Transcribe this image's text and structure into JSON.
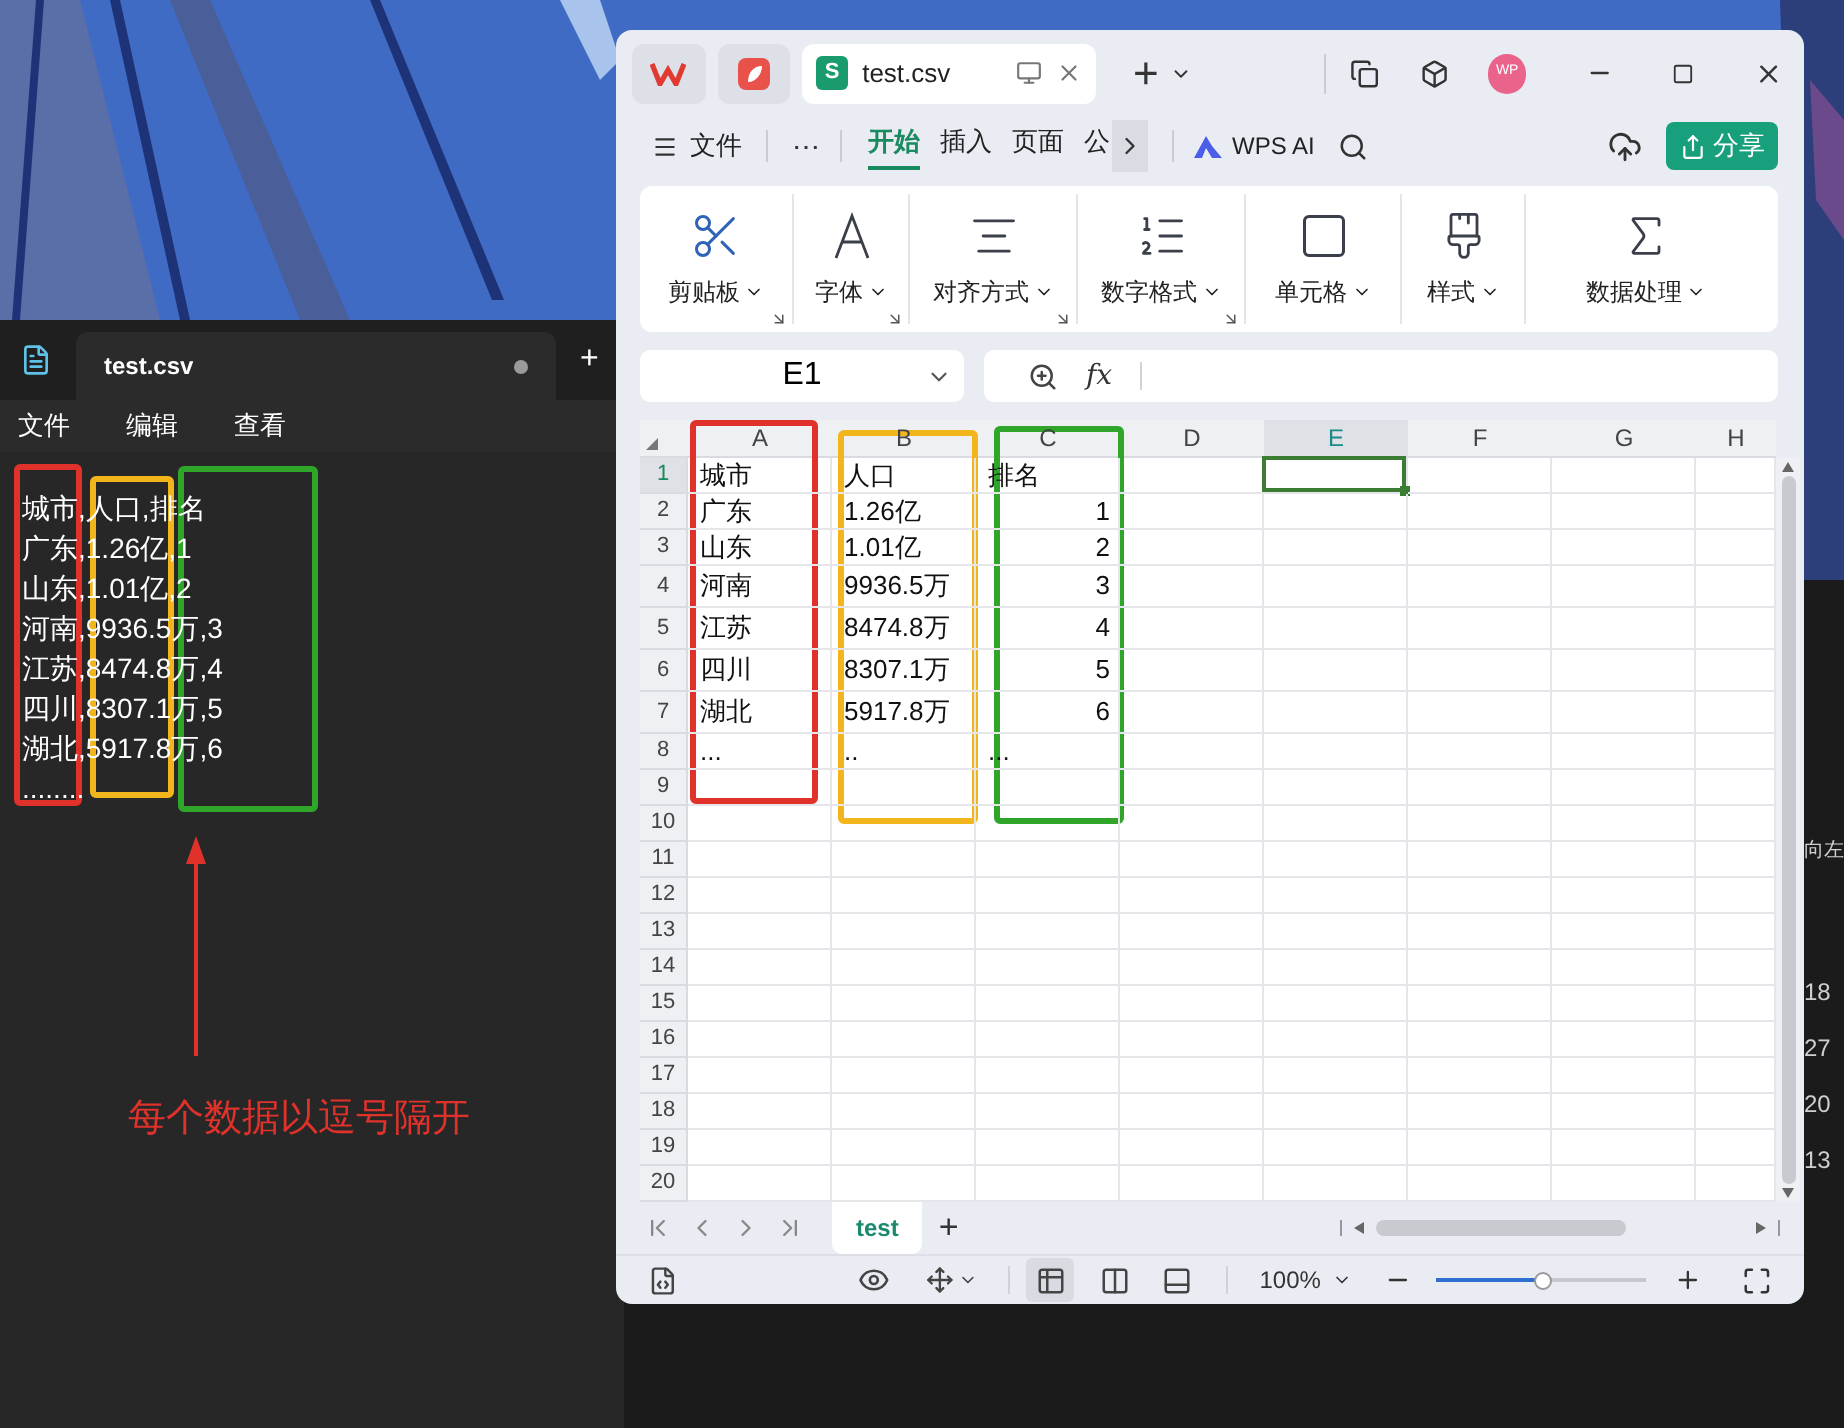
{
  "notepad": {
    "tab": {
      "title": "test.csv",
      "unsaved": true
    },
    "new_tab": "+",
    "menu": [
      "文件",
      "编辑",
      "查看"
    ],
    "lines": [
      "城市,人口,排名",
      "广东,1.26亿,1",
      "山东,1.01亿,2",
      "河南,9936.5万,3",
      "江苏,8474.8万,4",
      "四川,8307.1万,5",
      "湖北,5917.8万,6",
      "........"
    ]
  },
  "background_window": {
    "texts": [
      "向左",
      "18",
      "27",
      "20",
      "13"
    ]
  },
  "wps": {
    "document_tab": {
      "icon_letter": "S",
      "title": "test.csv"
    },
    "new_tab": "+",
    "avatar": "WP",
    "file_menu": "文件",
    "more": "⋯",
    "tabs": [
      {
        "label": "开始",
        "selected": true
      },
      {
        "label": "插入",
        "selected": false
      },
      {
        "label": "页面",
        "selected": false
      },
      {
        "label": "公",
        "selected": false
      }
    ],
    "ai_button": "WPS AI",
    "share_button": "分享",
    "ribbon_groups": [
      {
        "kind": "clipboard",
        "label": "剪贴板",
        "launcher": true
      },
      {
        "kind": "font",
        "label": "字体",
        "launcher": true
      },
      {
        "kind": "align",
        "label": "对齐方式",
        "launcher": true
      },
      {
        "kind": "number",
        "label": "数字格式",
        "launcher": true
      },
      {
        "kind": "cell",
        "label": "单元格",
        "launcher": false
      },
      {
        "kind": "style",
        "label": "样式",
        "launcher": false
      },
      {
        "kind": "data",
        "label": "数据处理",
        "launcher": false
      }
    ],
    "name_box": "E1",
    "formula_label": "fx",
    "columns": [
      {
        "label": "A",
        "selected": false
      },
      {
        "label": "B",
        "selected": false
      },
      {
        "label": "C",
        "selected": false
      },
      {
        "label": "D",
        "selected": false
      },
      {
        "label": "E",
        "selected": true
      },
      {
        "label": "F",
        "selected": false
      },
      {
        "label": "G",
        "selected": false
      },
      {
        "label": "H",
        "selected": false
      }
    ],
    "rows": [
      {
        "header": "1",
        "selected": true,
        "cells": [
          {
            "kind": "text",
            "text": "城市"
          },
          {
            "kind": "text",
            "text": "人口"
          },
          {
            "kind": "text",
            "text": "排名"
          }
        ]
      },
      {
        "header": "2",
        "selected": false,
        "cells": [
          {
            "kind": "text",
            "text": "广东"
          },
          {
            "kind": "text",
            "text": "1.26亿"
          },
          {
            "kind": "number",
            "text": "1"
          }
        ]
      },
      {
        "header": "3",
        "selected": false,
        "cells": [
          {
            "kind": "text",
            "text": "山东"
          },
          {
            "kind": "text",
            "text": "1.01亿"
          },
          {
            "kind": "number",
            "text": "2"
          }
        ]
      },
      {
        "header": "4",
        "selected": false,
        "cells": [
          {
            "kind": "text",
            "text": "河南"
          },
          {
            "kind": "text",
            "text": "9936.5万"
          },
          {
            "kind": "number",
            "text": "3"
          }
        ]
      },
      {
        "header": "5",
        "selected": false,
        "cells": [
          {
            "kind": "text",
            "text": "江苏"
          },
          {
            "kind": "text",
            "text": "8474.8万"
          },
          {
            "kind": "number",
            "text": "4"
          }
        ]
      },
      {
        "header": "6",
        "selected": false,
        "cells": [
          {
            "kind": "text",
            "text": "四川"
          },
          {
            "kind": "text",
            "text": "8307.1万"
          },
          {
            "kind": "number",
            "text": "5"
          }
        ]
      },
      {
        "header": "7",
        "selected": false,
        "cells": [
          {
            "kind": "text",
            "text": "湖北"
          },
          {
            "kind": "text",
            "text": "5917.8万"
          },
          {
            "kind": "number",
            "text": "6"
          }
        ]
      },
      {
        "header": "8",
        "selected": false,
        "cells": [
          {
            "kind": "text",
            "text": "..."
          },
          {
            "kind": "text",
            "text": ".."
          },
          {
            "kind": "text",
            "text": "..."
          }
        ]
      },
      {
        "header": "9",
        "selected": false
      },
      {
        "header": "10",
        "selected": false
      },
      {
        "header": "11",
        "selected": false
      },
      {
        "header": "12",
        "selected": false
      },
      {
        "header": "13",
        "selected": false
      },
      {
        "header": "14",
        "selected": false
      },
      {
        "header": "15",
        "selected": false
      },
      {
        "header": "16",
        "selected": false
      },
      {
        "header": "17",
        "selected": false
      },
      {
        "header": "18",
        "selected": false
      },
      {
        "header": "19",
        "selected": false
      },
      {
        "header": "20",
        "selected": false
      }
    ],
    "sheet_tabs": [
      {
        "label": "test",
        "selected": true
      }
    ],
    "add_sheet": "+",
    "view_modes": [
      {
        "kind": "normal",
        "selected": true
      },
      {
        "kind": "split",
        "selected": false
      },
      {
        "kind": "page",
        "selected": false
      }
    ],
    "zoom": {
      "reading": "100%",
      "level": 0.5
    }
  },
  "annotations": {
    "frames": [
      {
        "color": "#e0322b"
      },
      {
        "color": "#f2b51c"
      },
      {
        "color": "#2fa52a"
      },
      {
        "color": "#e0322b"
      },
      {
        "color": "#f2b51c"
      },
      {
        "color": "#2fa52a"
      }
    ],
    "caption": "每个数据以逗号隔开"
  }
}
